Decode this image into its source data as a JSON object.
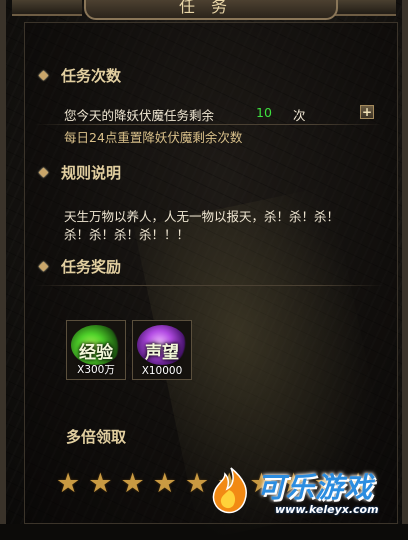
{
  "window": {
    "title": "任务"
  },
  "sections": {
    "task_count": {
      "heading": "任务次数"
    },
    "rules": {
      "heading": "规则说明"
    },
    "rewards": {
      "heading": "任务奖励"
    },
    "multiplier": {
      "heading": "多倍领取"
    }
  },
  "task_count": {
    "remaining_prefix": "您今天的降妖伏魔任务剩余",
    "remaining_value": "10",
    "remaining_unit": "次",
    "reset_note": "每日24点重置降妖伏魔剩余次数",
    "plus_label": "+"
  },
  "rules": {
    "line1": "天生万物以养人，人无一物以报天，杀！杀！杀！",
    "line2": "杀！杀！杀！杀！！！"
  },
  "rewards": {
    "items": [
      {
        "name": "经验",
        "quantity": "X300万",
        "icon": "green-orb-icon",
        "color": "#4fd12a"
      },
      {
        "name": "声望",
        "quantity": "X10000",
        "icon": "purple-orb-icon",
        "color": "#b24be3"
      }
    ]
  },
  "multiplier": {
    "stars": [
      "★",
      "★",
      "★",
      "★",
      "★",
      "★",
      "★",
      "★",
      "★",
      "★"
    ],
    "star_icon": "star-icon"
  },
  "watermark": {
    "brand": "可乐游戏",
    "url": "www.keleyx.com",
    "accent": "#2c8de0"
  }
}
